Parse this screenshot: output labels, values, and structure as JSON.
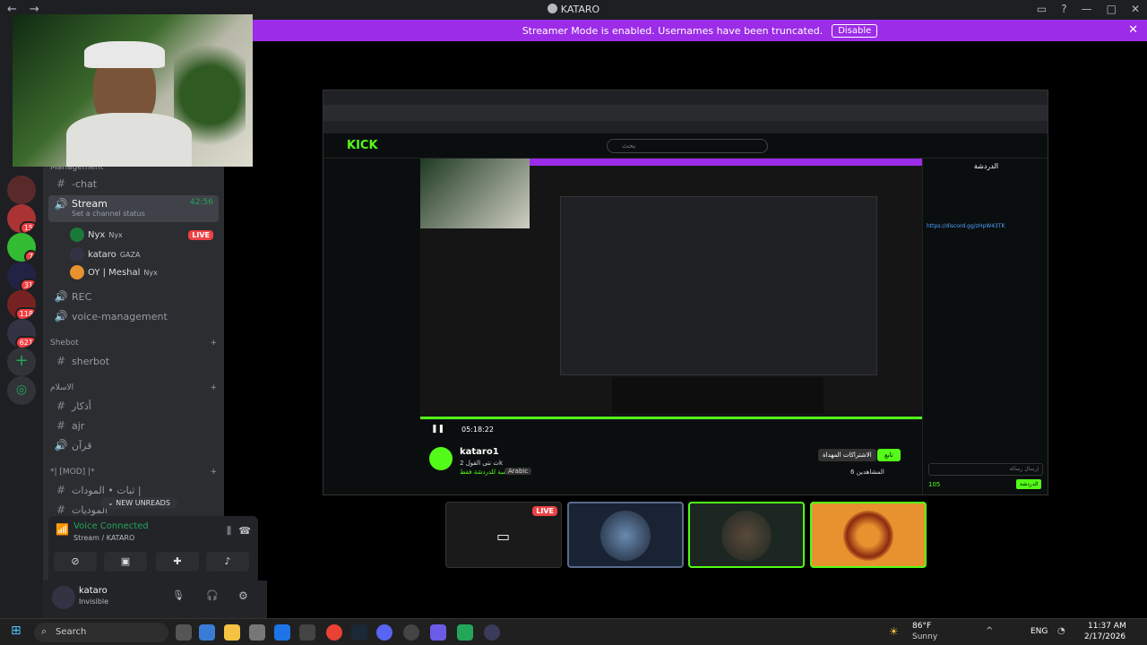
{
  "window": {
    "title": "KATARO"
  },
  "banner": {
    "text": "Streamer Mode is enabled. Usernames have been truncated.",
    "disable_label": "Disable"
  },
  "servers": [
    {
      "badge": ""
    },
    {
      "badge": ""
    },
    {
      "badge": "15"
    },
    {
      "badge": "7"
    },
    {
      "badge": "31"
    },
    {
      "badge": "118"
    },
    {
      "badge": "621"
    }
  ],
  "sidebar": {
    "category_management": "Management",
    "chat_channel": "-chat",
    "stream_channel": "Stream",
    "stream_timer": "42:56",
    "stream_status": "Set a channel status",
    "users": [
      {
        "name": "Nyx",
        "tag": "Nyx",
        "live": "LIVE"
      },
      {
        "name": "kataro",
        "tag": "GAZA",
        "live": ""
      },
      {
        "name": "OY | Meshal",
        "tag": "Nyx",
        "live": ""
      }
    ],
    "rec_channel": "REC",
    "voice_mgmt_channel": "voice-management",
    "category_shebot": "Shebot",
    "sherbot_channel": "sherbot",
    "category_islam": "الاسلام",
    "azkar_channel": "أذكار",
    "ajr_channel": "ajr",
    "quran_channel": "قرآن",
    "category_mod": "*| [MOD] |*",
    "mod_channel_1": "ثبات • المودات |",
    "mod_channel_2": "الموديات",
    "new_unreads": "NEW UNREADS"
  },
  "voice": {
    "status": "Voice Connected",
    "location": "Stream / KATARO"
  },
  "user_panel": {
    "name": "kataro",
    "status": "Invisible"
  },
  "stage": {
    "kick_logo": "KICK",
    "search_placeholder": "بحث",
    "streamer_name": "kataro1",
    "stream_title": "ث نتى القول 2k",
    "category": "محسبة للدردشة فقط",
    "language": "Arabic",
    "chat_header": "الدردشة",
    "chat_link": "https://discord.gg/zHpW43TK",
    "follow_label": "تابع",
    "subscribe_label": "الاشتراكات المهداة",
    "viewers": "6 المشاهدين",
    "time": "05:18:22",
    "chat_input": "إرسال رسالة",
    "chat_send": "الدردشة",
    "points": "105"
  },
  "tiles": [
    {
      "live": "LIVE"
    },
    {
      "live": ""
    },
    {
      "live": ""
    },
    {
      "live": ""
    }
  ],
  "taskbar": {
    "search": "Search",
    "weather_temp": "86°F",
    "weather_desc": "Sunny",
    "lang": "ENG",
    "time": "11:37 AM",
    "date": "2/17/2026"
  },
  "colors": {
    "brand": "#9c2ce8",
    "kick_green": "#53fc18",
    "discord_bg": "#2b2d31",
    "accent_orange": "#e8922f"
  }
}
